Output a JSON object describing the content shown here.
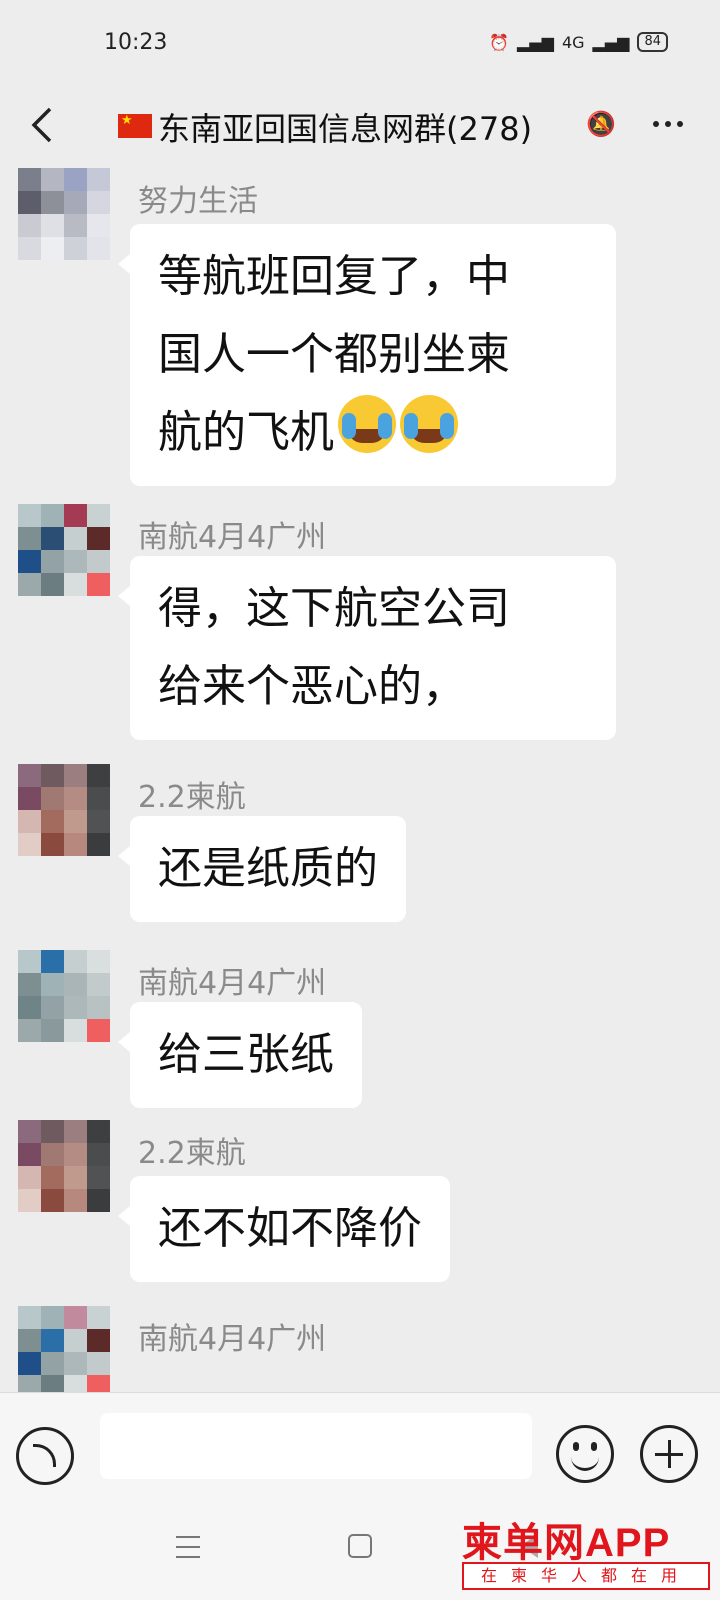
{
  "status_bar": {
    "time": "10:23",
    "network": "4G",
    "battery": "84"
  },
  "header": {
    "title": "东南亚回国信息网群(278)"
  },
  "messages": [
    {
      "sender": "努力生活",
      "lines": [
        "等航班回复了，中",
        "国人一个都别坐柬",
        "航的飞机"
      ],
      "emoji": "crying-emoji",
      "emoji_count": 2
    },
    {
      "sender": "南航4月4广州",
      "lines": [
        "得，这下航空公司",
        "给来个恶心的，"
      ]
    },
    {
      "sender": "2.2柬航",
      "lines": [
        "还是纸质的"
      ]
    },
    {
      "sender": "南航4月4广州",
      "lines": [
        "给三张纸"
      ]
    },
    {
      "sender": "2.2柬航",
      "lines": [
        "还不如不降价"
      ]
    },
    {
      "sender": "南航4月4广州",
      "lines": []
    }
  ],
  "input": {
    "value": "",
    "placeholder": ""
  },
  "watermark": {
    "brand": "柬单网APP",
    "tagline": "在柬华人都在用"
  },
  "colors": {
    "background": "#ededed",
    "bubble": "#ffffff",
    "sender_name": "#8a8a8a",
    "watermark_red": "#e0161c"
  }
}
